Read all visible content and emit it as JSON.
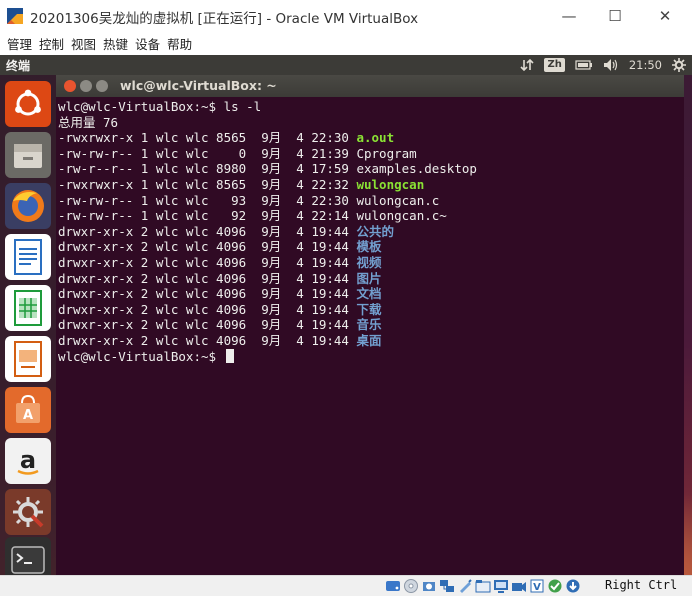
{
  "window": {
    "title": "20201306吴龙灿的虚拟机 [正在运行] - Oracle VM VirtualBox",
    "minimize": "—",
    "maximize": "☐",
    "close": "✕"
  },
  "menu": [
    "管理",
    "控制",
    "视图",
    "热键",
    "设备",
    "帮助"
  ],
  "ubuntu_panel": {
    "app_name": "终端",
    "input_method": "Zh",
    "clock": "21:50"
  },
  "terminal": {
    "title": "wlc@wlc-VirtualBox: ~",
    "prompt": "wlc@wlc-VirtualBox:~$ ",
    "command": "ls -l",
    "total_line": "总用量 76",
    "entries": [
      {
        "meta": "-rwxrwxr-x 1 wlc wlc 8565  9月  4 22:30 ",
        "name": "a.out",
        "kind": "exec"
      },
      {
        "meta": "-rw-rw-r-- 1 wlc wlc    0  9月  4 21:39 ",
        "name": "Cprogram",
        "kind": "file"
      },
      {
        "meta": "-rw-r--r-- 1 wlc wlc 8980  9月  4 17:59 ",
        "name": "examples.desktop",
        "kind": "file"
      },
      {
        "meta": "-rwxrwxr-x 1 wlc wlc 8565  9月  4 22:32 ",
        "name": "wulongcan",
        "kind": "exec"
      },
      {
        "meta": "-rw-rw-r-- 1 wlc wlc   93  9月  4 22:30 ",
        "name": "wulongcan.c",
        "kind": "file"
      },
      {
        "meta": "-rw-rw-r-- 1 wlc wlc   92  9月  4 22:14 ",
        "name": "wulongcan.c~",
        "kind": "file"
      },
      {
        "meta": "drwxr-xr-x 2 wlc wlc 4096  9月  4 19:44 ",
        "name": "公共的",
        "kind": "dir"
      },
      {
        "meta": "drwxr-xr-x 2 wlc wlc 4096  9月  4 19:44 ",
        "name": "模板",
        "kind": "dir"
      },
      {
        "meta": "drwxr-xr-x 2 wlc wlc 4096  9月  4 19:44 ",
        "name": "视频",
        "kind": "dir"
      },
      {
        "meta": "drwxr-xr-x 2 wlc wlc 4096  9月  4 19:44 ",
        "name": "图片",
        "kind": "dir"
      },
      {
        "meta": "drwxr-xr-x 2 wlc wlc 4096  9月  4 19:44 ",
        "name": "文档",
        "kind": "dir"
      },
      {
        "meta": "drwxr-xr-x 2 wlc wlc 4096  9月  4 19:44 ",
        "name": "下载",
        "kind": "dir"
      },
      {
        "meta": "drwxr-xr-x 2 wlc wlc 4096  9月  4 19:44 ",
        "name": "音乐",
        "kind": "dir"
      },
      {
        "meta": "drwxr-xr-x 2 wlc wlc 4096  9月  4 19:44 ",
        "name": "桌面",
        "kind": "dir"
      }
    ]
  },
  "launcher": [
    "ubuntu-dash-icon",
    "files-icon",
    "firefox-icon",
    "writer-icon",
    "calc-icon",
    "impress-icon",
    "software-center-icon",
    "amazon-icon",
    "system-settings-icon",
    "terminal-icon"
  ],
  "statusbar": {
    "host_key": "Right Ctrl"
  },
  "colors": {
    "terminal_bg": "#300a24",
    "exec": "#8ae234",
    "dir": "#729fcf",
    "text": "#eeeeec"
  }
}
